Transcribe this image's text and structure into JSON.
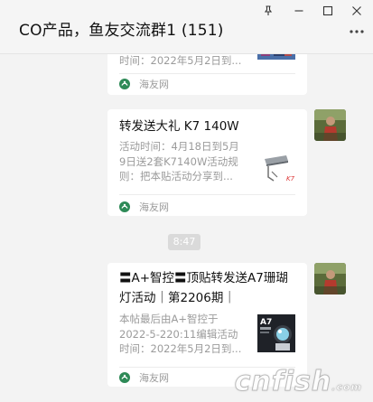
{
  "window": {
    "title": "CO产品，鱼友交流群1 (151)",
    "controls": {
      "pin_icon": "pin-icon",
      "minimize_icon": "minimize-icon",
      "maximize_icon": "maximize-icon",
      "close_icon": "close-icon",
      "more_icon": "more-dots-icon"
    }
  },
  "messages": [
    {
      "type": "link-card",
      "title": "",
      "desc": "时间：2022年5月2日到...",
      "source": "海友网",
      "thumb_icon": "event-banner-thumbnail"
    },
    {
      "type": "link-card",
      "title": "转发送大礼 K7 140W",
      "desc": "活动时间：4月18日到5月9日送2套K7140W活动规则：把本贴活动分享到...",
      "source": "海友网",
      "thumb_icon": "aquarium-light-thumbnail",
      "thumb_label": "K7"
    },
    {
      "type": "timestamp",
      "text": "8:47"
    },
    {
      "type": "link-card",
      "title": "〓A+智控〓顶贴转发送A7珊瑚灯活动｜第2206期｜",
      "desc": "本帖最后由A+智控于2022-5-220:11编辑活动时间：2022年5月2日到...",
      "source": "海友网",
      "thumb_icon": "a7-light-thumbnail",
      "thumb_label": "A7"
    }
  ],
  "watermark": {
    "text": "cnfish",
    "tld": ".com"
  },
  "colors": {
    "background": "#f3f3f3",
    "card": "#ffffff",
    "muted_text": "#9b9b9b",
    "timestamp_bg": "#dadada",
    "source_icon": "#2e8a57"
  }
}
